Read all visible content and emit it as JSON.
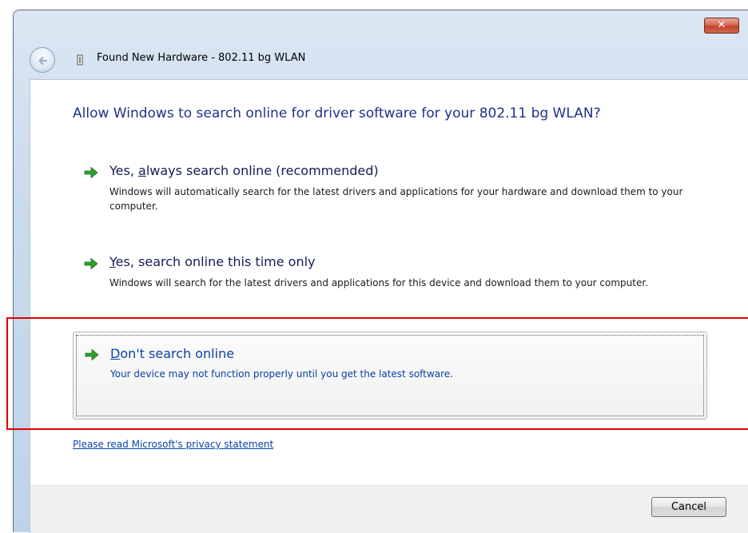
{
  "window": {
    "title": "Found New Hardware - 802.11 bg WLAN",
    "close_label": "✕"
  },
  "heading": "Allow Windows to search online for driver software for your 802.11 bg WLAN?",
  "options": [
    {
      "title_prefix": "Yes, ",
      "title_accel": "a",
      "title_suffix": "lways search online (recommended)",
      "description": "Windows will automatically search for the latest drivers and applications for your hardware and download them to your computer."
    },
    {
      "title_prefix": "",
      "title_accel": "Y",
      "title_suffix": "es, search online this time only",
      "description": "Windows will search for the latest drivers and applications for this device and download them to your computer."
    },
    {
      "title_prefix": "",
      "title_accel": "D",
      "title_suffix": "on't search online",
      "description": "Your device may not function properly until you get the latest software."
    }
  ],
  "privacy_link": "Please read Microsoft's  privacy statement",
  "cancel_label": "Cancel",
  "colors": {
    "heading": "#1e3287",
    "link": "#0645ad",
    "arrow_green": "#2e9e2e",
    "highlight_red": "#e00000"
  },
  "icons": {
    "back": "back-arrow-icon",
    "hardware": "hardware-device-icon",
    "option_arrow": "green-arrow-icon",
    "close": "close-icon"
  }
}
